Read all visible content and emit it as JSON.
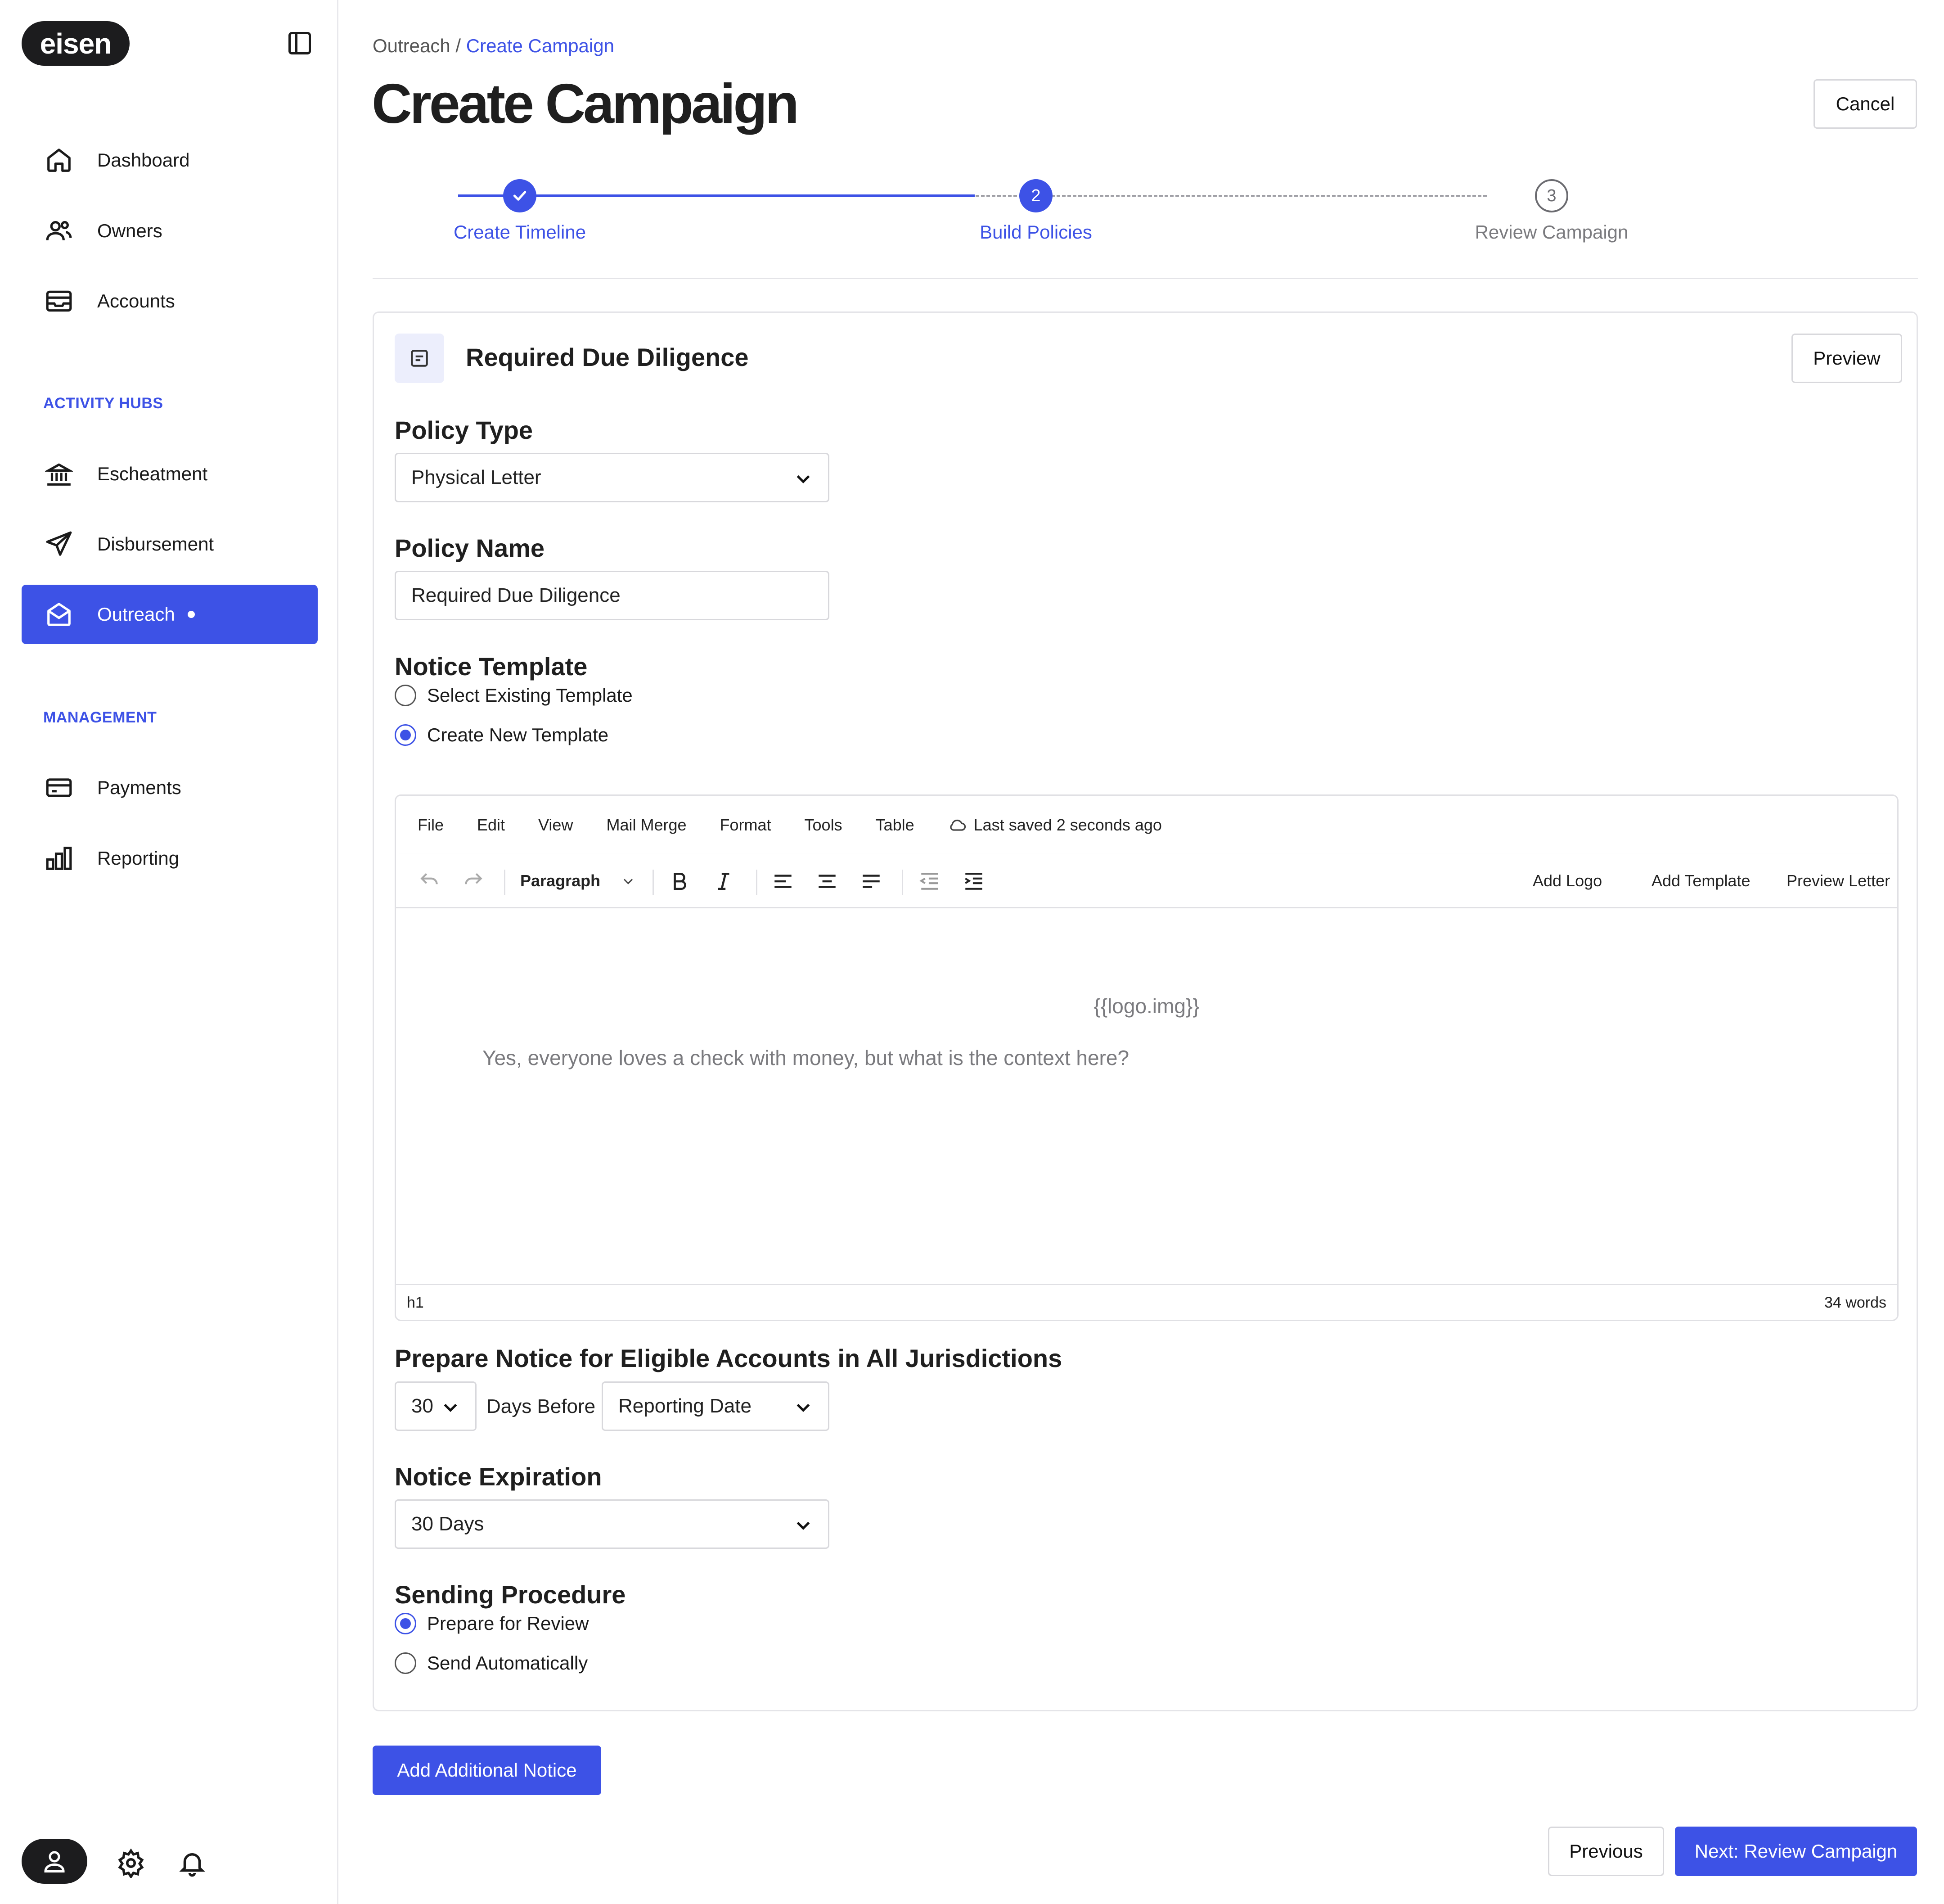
{
  "app": {
    "logo": "eisen"
  },
  "sidebar": {
    "items": [
      {
        "label": "Dashboard",
        "icon": "home-icon"
      },
      {
        "label": "Owners",
        "icon": "users-icon"
      },
      {
        "label": "Accounts",
        "icon": "inbox-icon"
      }
    ],
    "sections": {
      "activity_hubs": "ACTIVITY HUBS",
      "management": "MANAGEMENT"
    },
    "activity_items": [
      {
        "label": "Escheatment",
        "icon": "bank-icon"
      },
      {
        "label": "Disbursement",
        "icon": "send-icon"
      },
      {
        "label": "Outreach",
        "icon": "mail-open-icon",
        "active": true
      }
    ],
    "management_items": [
      {
        "label": "Payments",
        "icon": "credit-card-icon"
      },
      {
        "label": "Reporting",
        "icon": "bar-chart-icon"
      }
    ]
  },
  "breadcrumb": {
    "parent": "Outreach",
    "separator": " / ",
    "current": "Create Campaign"
  },
  "page": {
    "title": "Create Campaign",
    "cancel_label": "Cancel"
  },
  "stepper": {
    "steps": [
      {
        "label": "Create Timeline",
        "state": "complete"
      },
      {
        "label": "Build Policies",
        "number": "2",
        "state": "current"
      },
      {
        "label": "Review Campaign",
        "number": "3",
        "state": "upcoming"
      }
    ]
  },
  "card": {
    "title": "Required Due Diligence",
    "preview_label": "Preview",
    "policy_type": {
      "label": "Policy Type",
      "value": "Physical Letter"
    },
    "policy_name": {
      "label": "Policy Name",
      "value": "Required Due Diligence"
    },
    "notice_template": {
      "label": "Notice Template",
      "options": [
        "Select Existing Template",
        "Create New Template"
      ],
      "selected": 1
    },
    "editor": {
      "menu": [
        "File",
        "Edit",
        "View",
        "Mail Merge",
        "Format",
        "Tools",
        "Table"
      ],
      "saved_status": "Last saved 2 seconds ago",
      "block_format": "Paragraph",
      "actions": [
        "Add Logo",
        "Add Template",
        "Preview Letter"
      ],
      "body_logo": "{{logo.img}}",
      "body_text": "Yes, everyone loves a check with money, but what is the context here?",
      "status_element": "h1",
      "word_count": "34 words"
    },
    "prepare_notice": {
      "label": "Prepare Notice for Eligible Accounts in All Jurisdictions",
      "days": "30",
      "days_before_text": "Days Before",
      "date_type": "Reporting Date"
    },
    "notice_expiration": {
      "label": "Notice Expiration",
      "value": "30 Days"
    },
    "sending_procedure": {
      "label": "Sending Procedure",
      "options": [
        "Prepare for Review",
        "Send Automatically"
      ],
      "selected": 0
    }
  },
  "footer": {
    "add_notice_label": "Add Additional Notice",
    "previous_label": "Previous",
    "next_label": "Next: Review Campaign"
  },
  "colors": {
    "accent": "#3d52e6",
    "dark": "#1c1c1e",
    "border": "#d8d8dc",
    "muted": "#8a8a8a"
  }
}
